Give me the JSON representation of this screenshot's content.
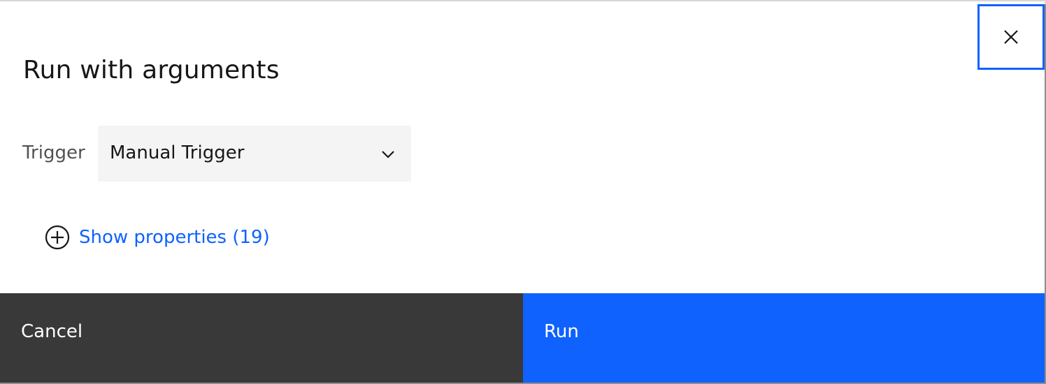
{
  "dialog": {
    "title": "Run with arguments",
    "close_icon": "close-icon"
  },
  "form": {
    "trigger_label": "Trigger",
    "trigger_value": "Manual Trigger",
    "dropdown_icon": "chevron-down-icon"
  },
  "properties": {
    "toggle_label": "Show properties (19)",
    "toggle_icon": "add-circle-icon"
  },
  "footer": {
    "cancel_label": "Cancel",
    "run_label": "Run"
  },
  "colors": {
    "primary": "#0f62fe",
    "secondary_button": "#393939",
    "field_bg": "#f4f4f4",
    "text": "#161616"
  }
}
